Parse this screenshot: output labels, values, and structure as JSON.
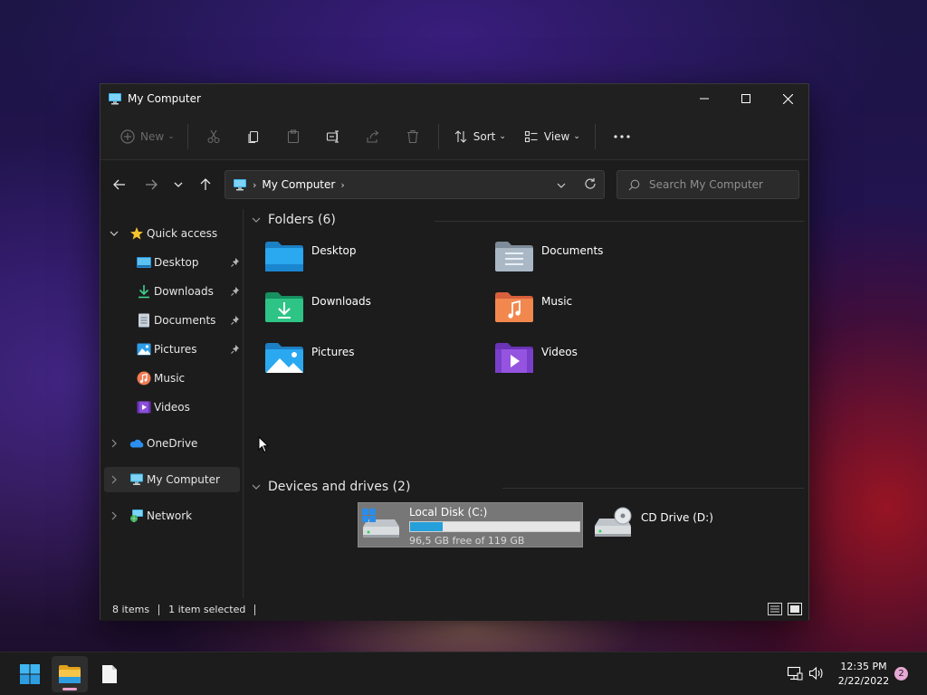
{
  "window": {
    "title": "My Computer"
  },
  "toolbar": {
    "new_label": "New",
    "sort_label": "Sort",
    "view_label": "View"
  },
  "address": {
    "crumb": "My Computer"
  },
  "search": {
    "placeholder": "Search My Computer"
  },
  "sidebar": {
    "quick_access": "Quick access",
    "items": [
      {
        "label": "Desktop"
      },
      {
        "label": "Downloads"
      },
      {
        "label": "Documents"
      },
      {
        "label": "Pictures"
      },
      {
        "label": "Music"
      },
      {
        "label": "Videos"
      }
    ],
    "onedrive": "OneDrive",
    "my_computer": "My Computer",
    "network": "Network"
  },
  "content": {
    "folders_header": "Folders (6)",
    "folders": [
      {
        "name": "Desktop",
        "icon": "desktop-folder-icon"
      },
      {
        "name": "Documents",
        "icon": "documents-folder-icon"
      },
      {
        "name": "Downloads",
        "icon": "downloads-folder-icon"
      },
      {
        "name": "Music",
        "icon": "music-folder-icon"
      },
      {
        "name": "Pictures",
        "icon": "pictures-folder-icon"
      },
      {
        "name": "Videos",
        "icon": "videos-folder-icon"
      }
    ],
    "drives_header": "Devices and drives (2)",
    "drives": [
      {
        "name": "Local Disk (C:)",
        "free_text": "96,5 GB free of 119 GB",
        "used_fraction": 0.19
      },
      {
        "name": "CD Drive (D:)"
      }
    ]
  },
  "status": {
    "items": "8 items",
    "selected": "1 item selected"
  },
  "taskbar": {
    "time": "12:35 PM",
    "date": "2/22/2022",
    "notifications": "2"
  },
  "colors": {
    "accent": "#26a0da",
    "window_bg": "#1e1e1e",
    "taskbar_bg": "#1c1c1c"
  }
}
